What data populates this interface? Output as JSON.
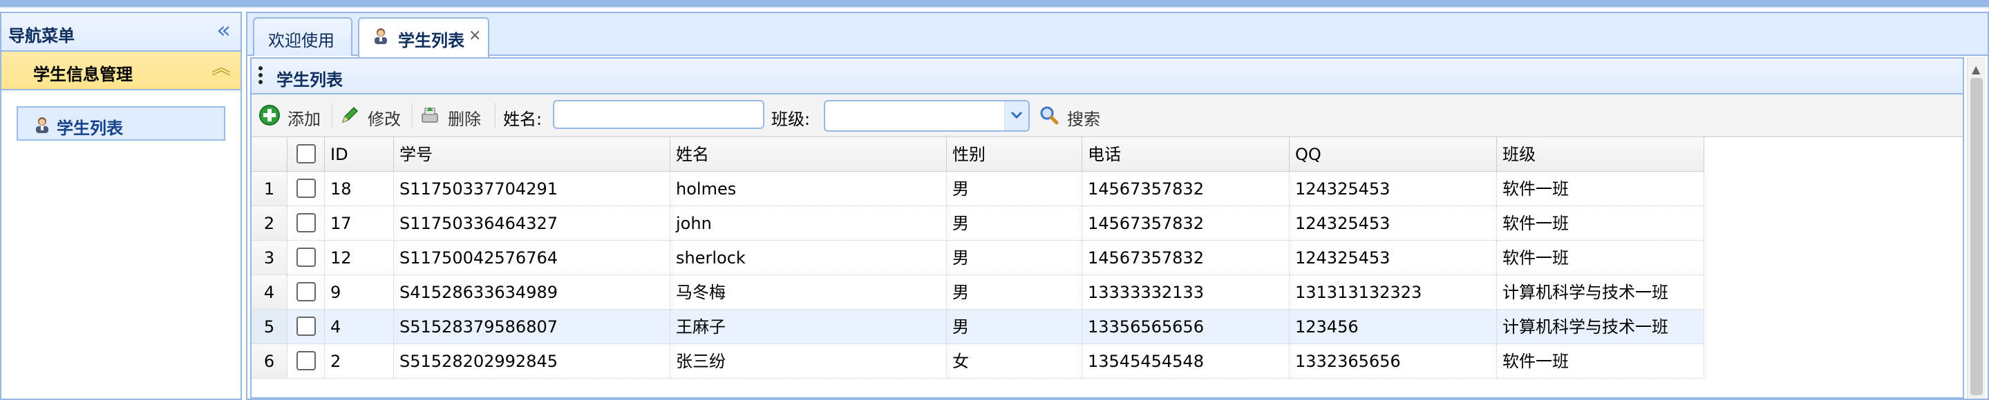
{
  "west": {
    "title": "导航菜单",
    "collapse_glyph": "«",
    "accordion_title": "学生信息管理",
    "accordion_toggle_glyph": "︽",
    "tree_item": "学生列表"
  },
  "tabs": [
    {
      "label": "欢迎使用"
    },
    {
      "label": "学生列表",
      "close": "×"
    }
  ],
  "panel": {
    "title": "学生列表",
    "toolbar": {
      "add": "添加",
      "edit": "修改",
      "delete": "删除",
      "name_label": "姓名:",
      "name_value": "",
      "class_label": "班级:",
      "class_value": "",
      "search": "搜索"
    }
  },
  "grid": {
    "columns": [
      "ID",
      "学号",
      "姓名",
      "性别",
      "电话",
      "QQ",
      "班级"
    ],
    "rows": [
      {
        "num": "1",
        "id": "18",
        "sn": "S11750337704291",
        "name": "holmes",
        "sex": "男",
        "phone": "14567357832",
        "qq": "124325453",
        "clazz": "软件一班"
      },
      {
        "num": "2",
        "id": "17",
        "sn": "S11750336464327",
        "name": "john",
        "sex": "男",
        "phone": "14567357832",
        "qq": "124325453",
        "clazz": "软件一班"
      },
      {
        "num": "3",
        "id": "12",
        "sn": "S11750042576764",
        "name": "sherlock",
        "sex": "男",
        "phone": "14567357832",
        "qq": "124325453",
        "clazz": "软件一班"
      },
      {
        "num": "4",
        "id": "9",
        "sn": "S41528633634989",
        "name": "马冬梅",
        "sex": "男",
        "phone": "13333332133",
        "qq": "131313132323",
        "clazz": "计算机科学与技术一班"
      },
      {
        "num": "5",
        "id": "4",
        "sn": "S51528379586807",
        "name": "王麻子",
        "sex": "男",
        "phone": "13356565656",
        "qq": "123456",
        "clazz": "计算机科学与技术一班"
      },
      {
        "num": "6",
        "id": "2",
        "sn": "S51528202992845",
        "name": "张三纷",
        "sex": "女",
        "phone": "13545454548",
        "qq": "1332365656",
        "clazz": "软件一班"
      }
    ]
  },
  "colors": {
    "border": "#95b8e7",
    "accordion_active": "#ffe48d",
    "selected_row": "#eaf2ff"
  }
}
